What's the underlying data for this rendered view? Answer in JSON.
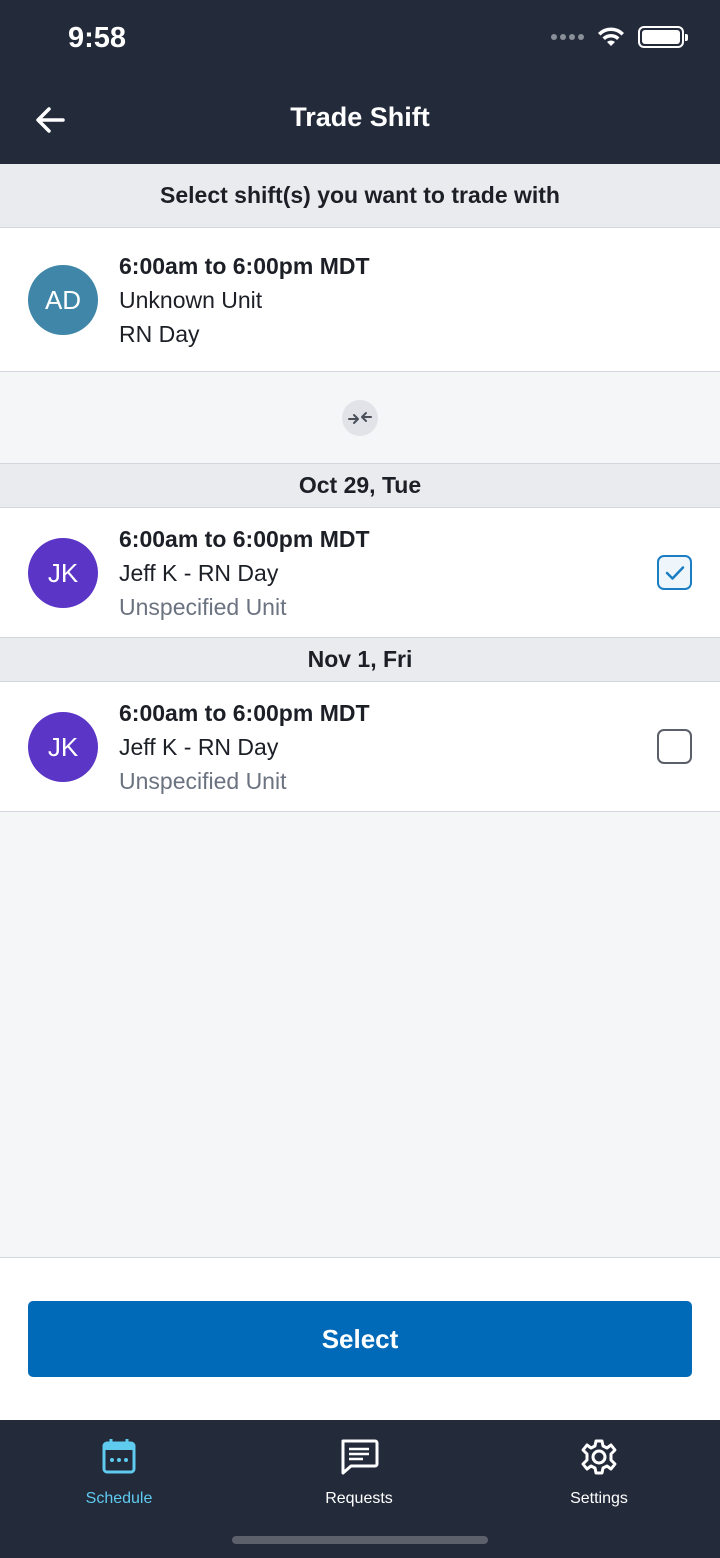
{
  "status_bar": {
    "time": "9:58"
  },
  "header": {
    "title": "Trade Shift"
  },
  "subheader": {
    "text": "Select shift(s) you want to trade with"
  },
  "my_shift": {
    "initials": "AD",
    "avatar_color": "#3f86a8",
    "time": "6:00am to 6:00pm MDT",
    "unit": "Unknown Unit",
    "role": "RN Day"
  },
  "trade_shifts": [
    {
      "date": "Oct 29, Tue",
      "initials": "JK",
      "avatar_color": "#5a35c6",
      "time": "6:00am to 6:00pm MDT",
      "person_role": "Jeff K - RN Day",
      "unit": "Unspecified Unit",
      "checked": true
    },
    {
      "date": "Nov 1, Fri",
      "initials": "JK",
      "avatar_color": "#5a35c6",
      "time": "6:00am to 6:00pm MDT",
      "person_role": "Jeff K - RN Day",
      "unit": "Unspecified Unit",
      "checked": false
    }
  ],
  "actions": {
    "select_label": "Select"
  },
  "tabbar": {
    "items": [
      {
        "label": "Schedule",
        "icon": "calendar-icon",
        "active": true
      },
      {
        "label": "Requests",
        "icon": "message-icon",
        "active": false
      },
      {
        "label": "Settings",
        "icon": "gear-icon",
        "active": false
      }
    ]
  },
  "colors": {
    "accent": "#0069b8",
    "header_bg": "#232a3a",
    "active_tab": "#5ecbef"
  }
}
